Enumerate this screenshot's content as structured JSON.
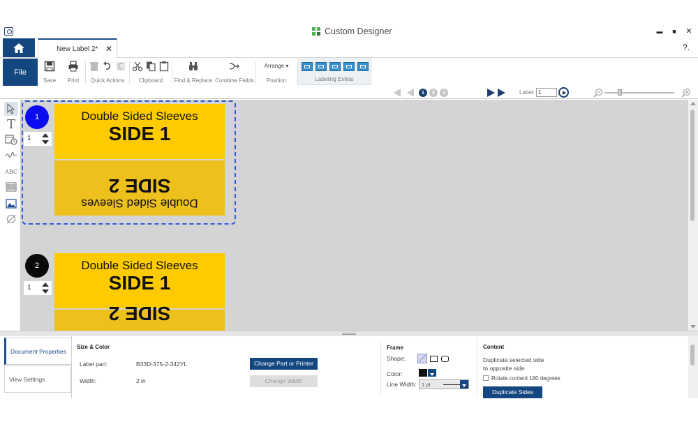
{
  "window": {
    "title": "Custom Designer",
    "minimize": "▬",
    "maximize": "■",
    "close": "✕",
    "help": "?."
  },
  "tabs": {
    "document_tab": "New Label 2*",
    "close": "✕"
  },
  "ribbon": {
    "file": "File",
    "save": "Save",
    "print": "Print",
    "quick_actions": "Quick Actions",
    "clipboard": "Clipboard",
    "find_replace": "Find & Replace",
    "combine_fields": "Combine Fields",
    "arrange": "Arrange ▾",
    "position": "Position",
    "labeling_extras": "Labeling Extras"
  },
  "navigation": {
    "pages": [
      "1",
      "2",
      "3"
    ],
    "label_text": "Label:",
    "label_value": "1"
  },
  "labels": [
    {
      "number": "1",
      "quantity": "1",
      "side1_line1": "Double Sided Sleeves",
      "side1_line2": "SIDE 1",
      "side2_line1": "Double Sided Sleeves",
      "side2_line2": "SIDE 2"
    },
    {
      "number": "2",
      "quantity": "1",
      "side1_line1": "Double Sided Sleeves",
      "side1_line2": "SIDE 1",
      "side2_line2": "SIDE 2"
    }
  ],
  "properties": {
    "tabs": [
      "Document Properties",
      "View Settings"
    ],
    "size_color": {
      "title": "Size & Color",
      "label_part_label": "Label part:",
      "label_part_value": "B33D-375-2-342YL",
      "width_label": "Width:",
      "width_value": "2 in",
      "change_part_button": "Change Part or Printer",
      "change_width_button": "Change Width"
    },
    "frame": {
      "title": "Frame",
      "shape_label": "Shape:",
      "color_label": "Color:",
      "line_width_label": "Line Width:",
      "line_width_value": "1 pt"
    },
    "content": {
      "title": "Content",
      "duplicate_text_1": "Duplicate selected side",
      "duplicate_text_2": "to opposite side",
      "rotate_label": "Rotate content 180 degrees",
      "duplicate_button": "Duplicate Sides"
    }
  },
  "colors": {
    "accent": "#14467f",
    "label_yellow": "#fdcb00",
    "selection": "#2f5bd9",
    "page_active": "#1b3e6e"
  }
}
